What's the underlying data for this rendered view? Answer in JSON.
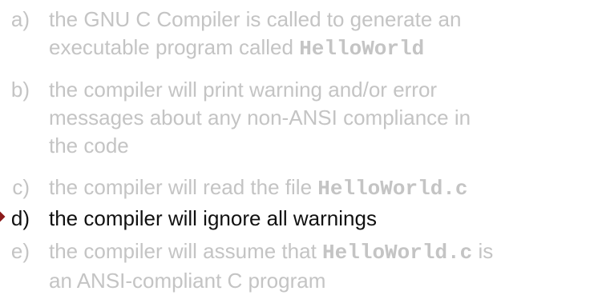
{
  "options": [
    {
      "marker": "a)",
      "lines": [
        {
          "text": "the GNU C Compiler is called to generate an"
        },
        {
          "text": "executable program called ",
          "code": "HelloWorld"
        }
      ]
    },
    {
      "marker": "b)",
      "lines": [
        {
          "text": "the compiler will print warning and/or error"
        },
        {
          "text": "messages about any non-ANSI compliance in"
        },
        {
          "text": "the code"
        }
      ]
    },
    {
      "marker": "c)",
      "lines": [
        {
          "text": "the compiler will read the file ",
          "code": "HelloWorld.c"
        }
      ]
    },
    {
      "marker": "d)",
      "lines": [
        {
          "text": "the compiler will ignore all warnings"
        }
      ]
    },
    {
      "marker": "e)",
      "lines": [
        {
          "text": "the compiler will assume that ",
          "code": "HelloWorld.c",
          "after": " is"
        },
        {
          "text": "an ANSI-compliant C program"
        }
      ]
    }
  ],
  "selected_option": "d)",
  "colors": {
    "inactive_text": "#c4c4c4",
    "selected_text": "#111111",
    "pointer": "#8b1a1a"
  }
}
